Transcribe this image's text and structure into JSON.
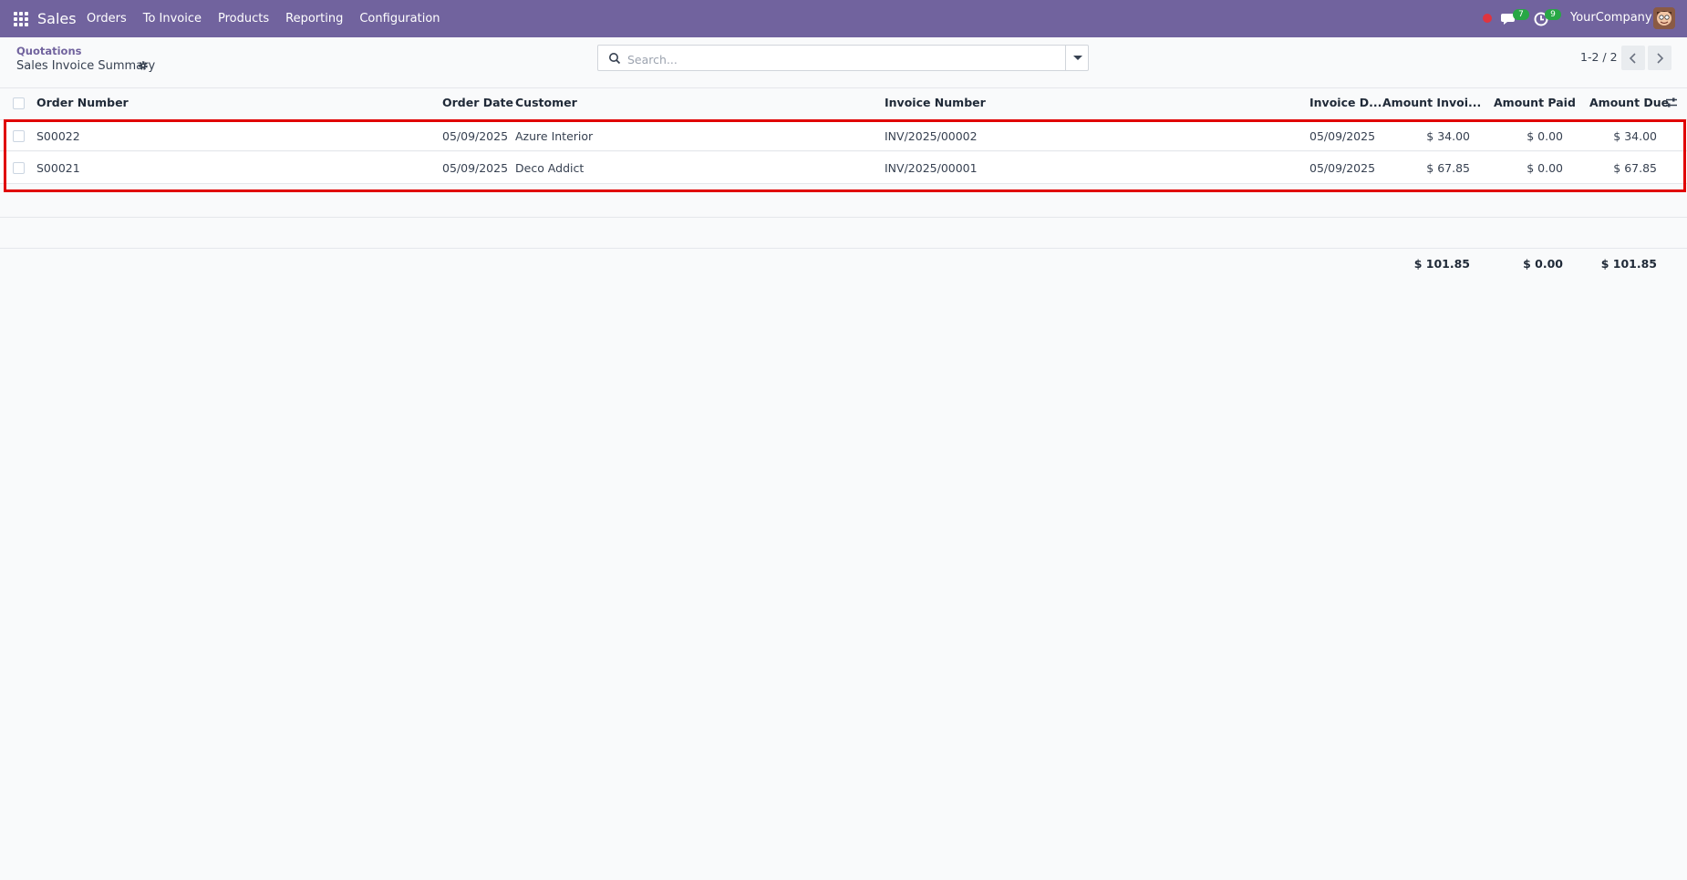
{
  "navbar": {
    "brand": "Sales",
    "menu": [
      "Orders",
      "To Invoice",
      "Products",
      "Reporting",
      "Configuration"
    ],
    "chat_badge": "7",
    "activity_badge": "9",
    "company": "YourCompany"
  },
  "control_panel": {
    "breadcrumb_parent": "Quotations",
    "title": "Sales Invoice Summary",
    "search_placeholder": "Search...",
    "pager": "1-2 / 2"
  },
  "table": {
    "columns": [
      "Order Number",
      "Order Date",
      "Customer",
      "Invoice Number",
      "Invoice D...",
      "Amount Invoi...",
      "Amount Paid",
      "Amount Due"
    ],
    "rows": [
      {
        "order_number": "S00022",
        "order_date": "05/09/2025",
        "customer": "Azure Interior",
        "invoice_number": "INV/2025/00002",
        "invoice_date": "05/09/2025",
        "amount_invoiced": "$ 34.00",
        "amount_paid": "$ 0.00",
        "amount_due": "$ 34.00"
      },
      {
        "order_number": "S00021",
        "order_date": "05/09/2025",
        "customer": "Deco Addict",
        "invoice_number": "INV/2025/00001",
        "invoice_date": "05/09/2025",
        "amount_invoiced": "$ 67.85",
        "amount_paid": "$ 0.00",
        "amount_due": "$ 67.85"
      }
    ],
    "totals": {
      "amount_invoiced": "$ 101.85",
      "amount_paid": "$ 0.00",
      "amount_due": "$ 101.85"
    }
  },
  "colors": {
    "navbar": "#71639e",
    "highlight": "#e00000",
    "badge": "#28a745"
  }
}
